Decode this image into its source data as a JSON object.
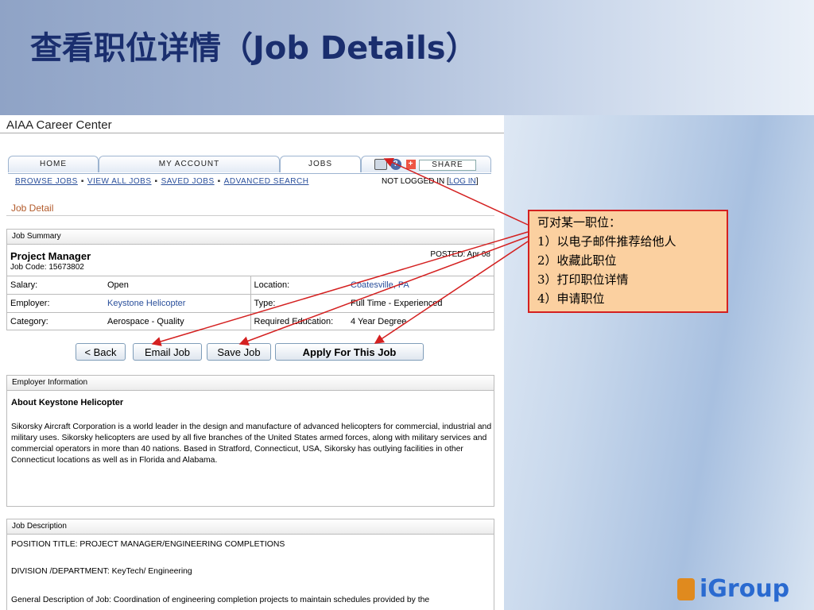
{
  "slide": {
    "title": "查看职位详情（Job Details）",
    "logo": "iGroup"
  },
  "site": {
    "title": "AIAA Career Center"
  },
  "nav": {
    "tabs": [
      "HOME",
      "MY ACCOUNT",
      "JOBS"
    ],
    "share": "SHARE",
    "help_glyph": "?",
    "share_glyph": "+",
    "subnav": [
      "BROWSE JOBS",
      "VIEW ALL JOBS",
      "SAVED JOBS",
      "ADVANCED SEARCH"
    ],
    "login_prefix": "NOT LOGGED IN [",
    "login_link": "LOG IN",
    "login_suffix": "]"
  },
  "page": {
    "heading": "Job Detail"
  },
  "summary": {
    "header": "Job Summary",
    "title": "Project Manager",
    "job_code": "Job Code: 15673802",
    "posted": "POSTED: Apr 08",
    "rows": [
      {
        "l1": "Salary:",
        "v1": "Open",
        "l2": "Location:",
        "v2": "Coatesville, PA"
      },
      {
        "l1": "Employer:",
        "v1": "Keystone Helicopter",
        "l2": "Type:",
        "v2": "Full Time - Experienced"
      },
      {
        "l1": "Category:",
        "v1": "Aerospace - Quality",
        "l2": "Required Education:",
        "v2": "4 Year Degree"
      }
    ]
  },
  "buttons": {
    "back": "< Back",
    "email": "Email Job",
    "save": "Save Job",
    "apply": "Apply For This Job"
  },
  "employer": {
    "header": "Employer Information",
    "name": "About Keystone Helicopter",
    "text": "Sikorsky Aircraft Corporation is a world leader in the design and manufacture of advanced helicopters for commercial, industrial and military uses. Sikorsky helicopters are used by all five branches of the United States armed forces, along with military services and commercial operators in more than 40 nations. Based in Stratford, Connecticut, USA, Sikorsky has outlying facilities in other Connecticut locations as well as in Florida and Alabama."
  },
  "description": {
    "header": "Job Description",
    "lines": [
      "POSITION TITLE: PROJECT MANAGER/ENGINEERING COMPLETIONS",
      "DIVISION /DEPARTMENT: KeyTech/ Engineering",
      "General Description of Job: Coordination of engineering completion projects to maintain schedules provided by the"
    ]
  },
  "callout": {
    "lines": [
      "可对某一职位：",
      "1）以电子邮件推荐给他人",
      "2）收藏此职位",
      "3）打印职位详情",
      "4）申请职位"
    ]
  },
  "colors": {
    "title": "#1a2e6e",
    "link": "#2a4f9b",
    "callout_bg": "#fbd0a0",
    "callout_border": "#d42020",
    "heading": "#b25a2a",
    "logo": "#2a6ad0"
  }
}
